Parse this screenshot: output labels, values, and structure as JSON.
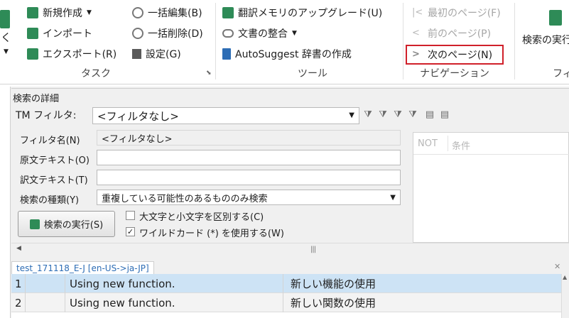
{
  "ribbon": {
    "open_label": "開く",
    "task": {
      "group_label": "タスク",
      "new_label": "新規作成",
      "import_label": "インポート",
      "export_label": "エクスポート(R)",
      "batch_edit_label": "一括編集(B)",
      "batch_delete_label": "一括削除(D)",
      "settings_label": "設定(G)"
    },
    "tools": {
      "group_label": "ツール",
      "upgrade_label": "翻訳メモリのアップグレード(U)",
      "align_label": "文書の整合",
      "autosuggest_label": "AutoSuggest 辞書の作成"
    },
    "navigation": {
      "group_label": "ナビゲーション",
      "first_label": "最初のページ(F)",
      "prev_label": "前のページ(P)",
      "next_label": "次のページ(N)"
    },
    "search": {
      "run_label": "検索の実行",
      "group_label_partial": "フィ"
    },
    "highlight_color": "#d0202a"
  },
  "search_panel": {
    "title": "検索の詳細",
    "tm_filter_label": "TM フィルタ:",
    "tm_filter_value": "<フィルタなし>",
    "filter_name_label": "フィルタ名(N)",
    "filter_name_value": "<フィルタなし>",
    "source_text_label": "原文テキスト(O)",
    "source_text_value": "",
    "target_text_label": "訳文テキスト(T)",
    "target_text_value": "",
    "search_type_label": "検索の種類(Y)",
    "search_type_value": "重複している可能性のあるもののみ検索",
    "execute_button_label": "検索の実行(S)",
    "match_case_label": "大文字と小文字を区別する(C)",
    "match_case_checked": false,
    "wildcard_label": "ワイルドカード (*) を使用する(W)",
    "wildcard_checked": true,
    "conditions": {
      "col_not": "NOT",
      "col_condition": "条件"
    }
  },
  "document": {
    "tab_label": "test_171118_E-J [en-US->ja-JP]",
    "rows": [
      {
        "num": "1",
        "source": "Using new function.",
        "target": "新しい機能の使用",
        "selected": true
      },
      {
        "num": "2",
        "source": "Using new function.",
        "target": "新しい関数の使用",
        "selected": false
      }
    ]
  }
}
